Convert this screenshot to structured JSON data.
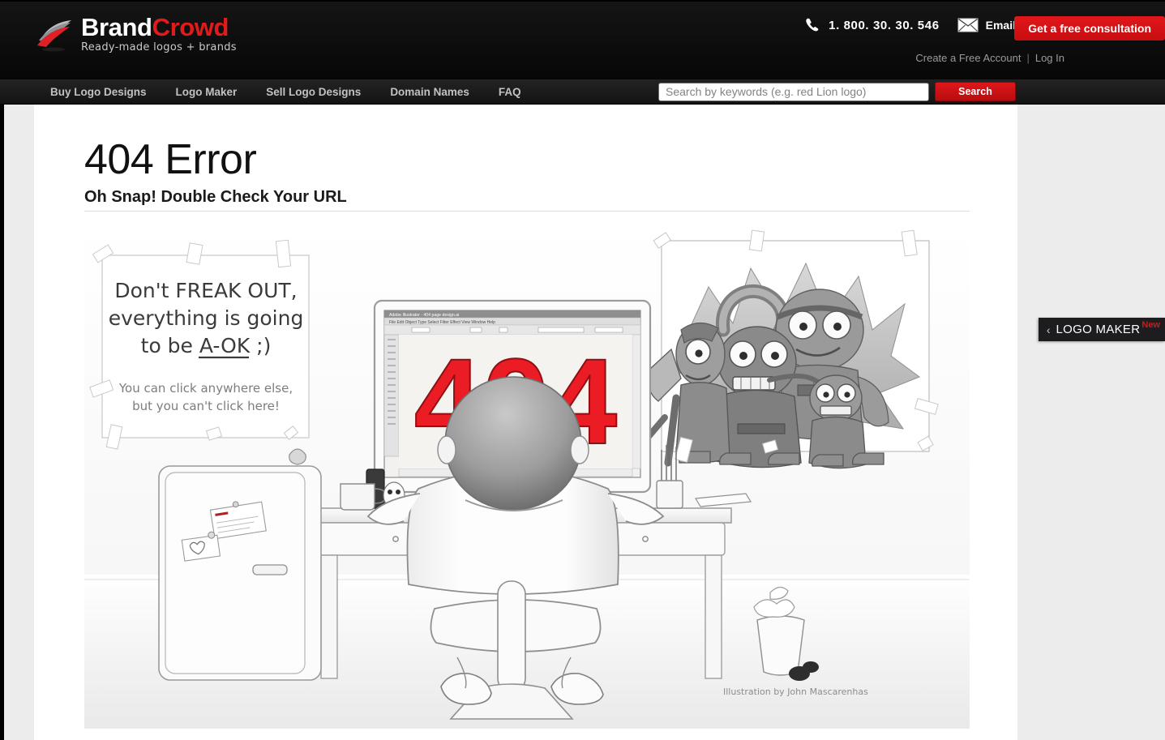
{
  "brand": {
    "name_part1": "Brand",
    "name_part2": "Crowd",
    "tagline": "Ready-made logos + brands"
  },
  "header": {
    "phone": "1. 800. 30. 30. 546",
    "email_label": "Email",
    "cta_label": "Get a free consultation",
    "create_account_label": "Create a Free Account",
    "separator": "|",
    "login_label": "Log In",
    "accent_color": "#d10f12",
    "background_color": "#0d0d0d"
  },
  "nav": {
    "items": [
      {
        "label": "Buy Logo Designs"
      },
      {
        "label": "Logo Maker"
      },
      {
        "label": "Sell Logo Designs"
      },
      {
        "label": "Domain Names"
      },
      {
        "label": "FAQ"
      }
    ]
  },
  "search": {
    "placeholder": "Search by keywords (e.g. red Lion logo)",
    "value": "",
    "button_label": "Search"
  },
  "main": {
    "title": "404 Error",
    "subtitle": "Oh Snap! Double Check Your URL"
  },
  "illustration": {
    "note_line1": "Don't FREAK OUT,",
    "note_line2": "everything is going",
    "note_line3": "to be A-OK ;)",
    "note_small_line1": "You can click anywhere else,",
    "note_small_line2": "but you can't click here!",
    "screen_number": "404",
    "app_title": "Adobe Illustrator - 404 page design.ai",
    "app_menus": "File  Edit  Object  Type  Select  Filter  Effect  View  Window  Help",
    "credit": "Illustration by John Mascarenhas",
    "error_color": "#ec1c24"
  },
  "side_tab": {
    "chevron": "‹",
    "label": "LOGO MAKER",
    "badge": "New"
  }
}
